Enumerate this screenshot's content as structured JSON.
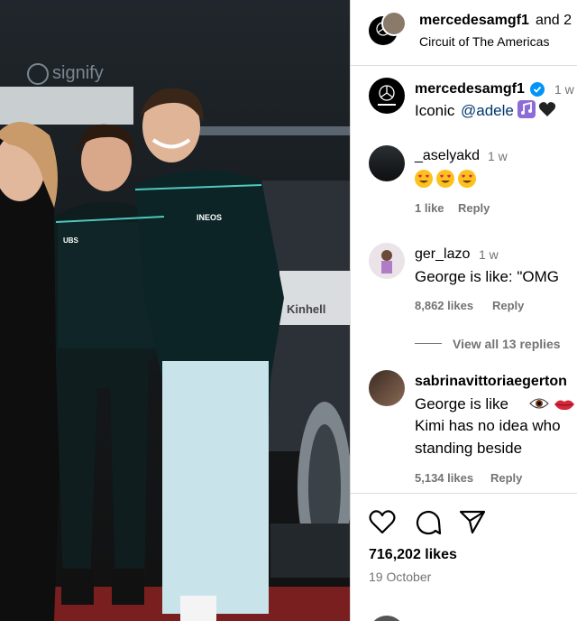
{
  "header": {
    "username": "mercedesamgf1",
    "and_more": "and 2",
    "location": "Circuit of The Americas"
  },
  "photo": {
    "sponsor_text": "signify",
    "shirt_text_1": "INEOS",
    "shirt_text_2": "UBS",
    "car_text": "Kinhell"
  },
  "caption": {
    "username": "mercedesamgf1",
    "time": "1 w",
    "text": "Iconic",
    "mention": "@adele"
  },
  "comments": [
    {
      "username": "_aselyakd",
      "time": "1 w",
      "likes": "1 like",
      "reply": "Reply"
    },
    {
      "username": "ger_lazo",
      "time": "1 w",
      "text": "George is like: \"OMG",
      "likes": "8,862 likes",
      "reply": "Reply",
      "view_replies": "View all 13 replies"
    },
    {
      "username": "sabrinavittoriaegerton",
      "text_line1": "George is like",
      "text_line2": "Kimi has no idea who",
      "text_line3": "standing beside",
      "likes": "5,134 likes",
      "reply": "Reply"
    }
  ],
  "post": {
    "likes": "716,202 likes",
    "date": "19 October"
  },
  "colors": {
    "verified": "#0095f6",
    "gray": "#737373",
    "mention": "#00376b"
  },
  "icons": [
    "mercedes-logo-icon",
    "verified-icon",
    "heart-icon",
    "comment-icon",
    "share-icon",
    "music-icon",
    "black-heart-icon",
    "heart-eyes-emoji",
    "eye-emoji",
    "lips-emoji"
  ]
}
